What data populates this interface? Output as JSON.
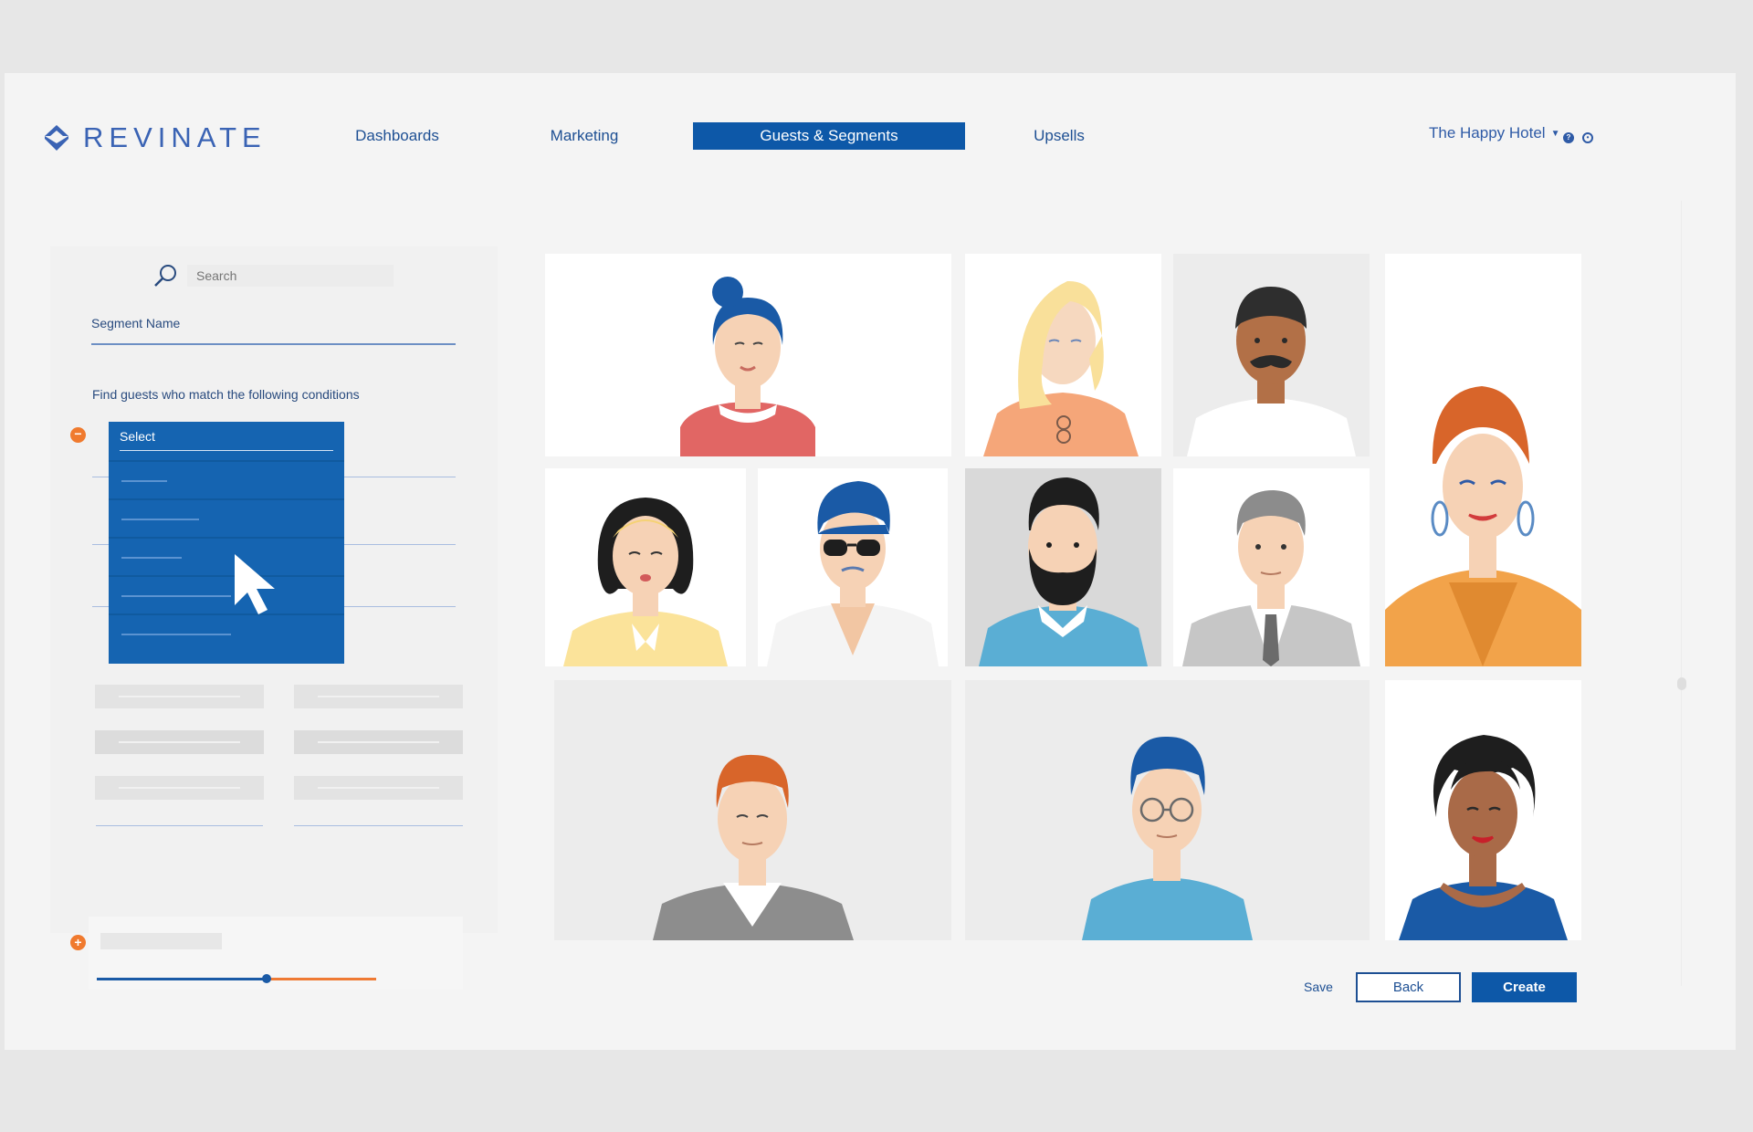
{
  "header": {
    "brand_name": "REVINATE",
    "brand_color": "#3a63b4",
    "nav": [
      {
        "label": "Dashboards",
        "active": false
      },
      {
        "label": "Marketing",
        "active": false
      },
      {
        "label": "Guests & Segments",
        "active": true
      },
      {
        "label": "Upsells",
        "active": false
      }
    ],
    "hotel_name": "The Happy Hotel",
    "hotel_caret_icon": "chevron-down-icon",
    "help_icon": "help-icon",
    "settings_icon": "gear-icon",
    "accent_color": "#0d58a8"
  },
  "segment_builder": {
    "search_placeholder": "Search",
    "search_icon": "search-icon",
    "segment_name_label": "Segment Name",
    "conditions_label": "Find guests who match the following conditions",
    "remove_condition_icon": "minus-icon",
    "add_condition_icon": "plus-icon",
    "dropdown": {
      "selected": "Select"
    },
    "slider_level": 0.6,
    "slider_colors": {
      "filled": "#1a5aa6",
      "remaining": "#ef7a34"
    }
  },
  "guest_grid": {
    "avatar_icons": [
      "woman-blue-bun-avatar",
      "woman-blonde-avatar",
      "man-mustache-avatar",
      "woman-red-hair-avatar",
      "woman-headband-avatar",
      "man-sunglasses-avatar",
      "man-beard-avatar",
      "man-gray-suit-avatar",
      "man-ginger-avatar",
      "man-glasses-avatar",
      "woman-curly-hair-avatar"
    ]
  },
  "actions": {
    "save_label": "Save",
    "back_label": "Back",
    "create_label": "Create"
  }
}
